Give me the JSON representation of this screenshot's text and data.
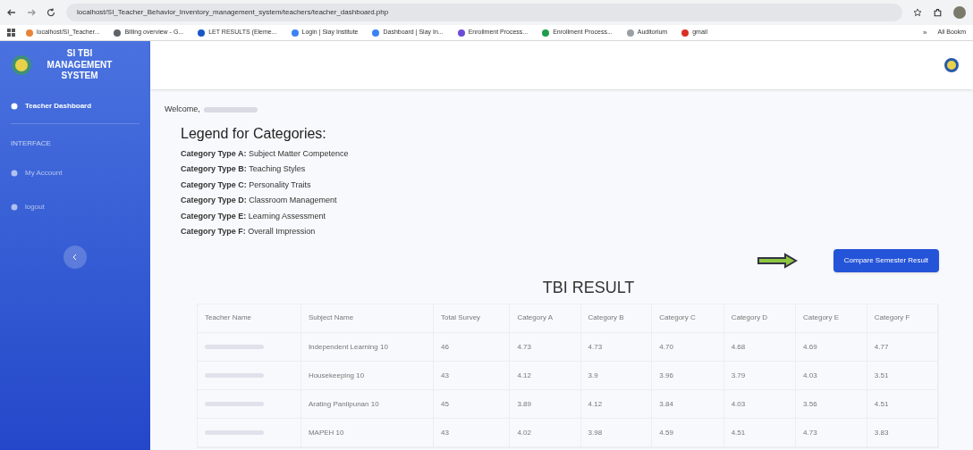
{
  "browser": {
    "url": "localhost/SI_Teacher_Behavior_Inventory_management_system/teachers/teacher_dashboard.php",
    "bookmarks": [
      {
        "label": "localhost/SI_Teacher...",
        "color": "#e8833a"
      },
      {
        "label": "Billing overview - G...",
        "color": "#5f6368"
      },
      {
        "label": "LET RESULTS (Eleme...",
        "color": "#1a56c4"
      },
      {
        "label": "Login | Siay Institute",
        "color": "#3b82f6"
      },
      {
        "label": "Dashboard | Siay In...",
        "color": "#3b82f6"
      },
      {
        "label": "Enrollment Process...",
        "color": "#6d4cd6"
      },
      {
        "label": "Enrollment Process...",
        "color": "#1e9e4a"
      },
      {
        "label": "Auditorium",
        "color": "#9aa0a6"
      },
      {
        "label": "gmail",
        "color": "#d93025"
      }
    ],
    "more_bookmarks": "»",
    "all_bookmarks": "All Bookm"
  },
  "sidebar": {
    "brand": "SI TBI MANAGEMENT SYSTEM",
    "items": [
      {
        "kind": "link",
        "label": "Teacher Dashboard",
        "selected": true
      },
      {
        "kind": "heading",
        "label": "INTERFACE"
      },
      {
        "kind": "link",
        "label": "My Account",
        "selected": false
      },
      {
        "kind": "link",
        "label": "logout",
        "selected": false
      }
    ]
  },
  "welcome": "Welcome,",
  "legend": {
    "title": "Legend for Categories:",
    "items": [
      {
        "type": "Category Type A:",
        "name": "Subject Matter Competence"
      },
      {
        "type": "Category Type B:",
        "name": "Teaching Styles"
      },
      {
        "type": "Category Type C:",
        "name": "Personality Traits"
      },
      {
        "type": "Category Type D:",
        "name": "Classroom Management"
      },
      {
        "type": "Category Type E:",
        "name": "Learning Assessment"
      },
      {
        "type": "Category Type F:",
        "name": "Overall Impression"
      }
    ]
  },
  "compare_button": "Compare Semester Result",
  "result_title": "TBI RESULT",
  "table": {
    "columns": [
      "Teacher Name",
      "Subject Name",
      "Total Survey",
      "Category A",
      "Category B",
      "Category C",
      "Category D",
      "Category E",
      "Category F"
    ],
    "rows": [
      [
        "",
        "Independent Learning 10",
        "46",
        "4.73",
        "4.73",
        "4.70",
        "4.68",
        "4.69",
        "4.77"
      ],
      [
        "",
        "Housekeeping 10",
        "43",
        "4.12",
        "3.9",
        "3.96",
        "3.79",
        "4.03",
        "3.51"
      ],
      [
        "",
        "Arating Panlipunan 10",
        "45",
        "3.89",
        "4.12",
        "3.84",
        "4.03",
        "3.56",
        "4.51"
      ],
      [
        "",
        "MAPEH 10",
        "43",
        "4.02",
        "3.98",
        "4.59",
        "4.51",
        "4.73",
        "3.83"
      ]
    ]
  }
}
